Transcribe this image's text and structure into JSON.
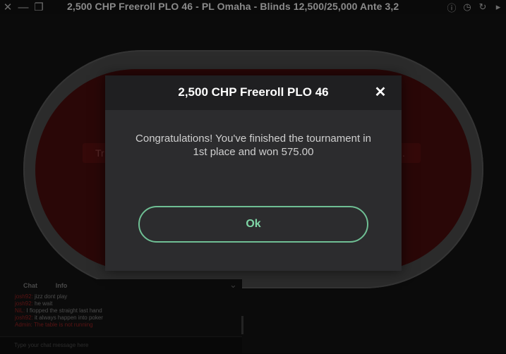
{
  "window": {
    "title": "2,500 CHP Freeroll PLO 46 - PL Omaha - Blinds 12,500/25,000 Ante 3,2"
  },
  "table": {
    "banner_left": "Tr",
    "banner_right": "."
  },
  "chat": {
    "tabs": [
      "Chat",
      "Info"
    ],
    "messages": [
      {
        "nick": "josh92:",
        "text": " jizz dont play"
      },
      {
        "nick": "josh92:",
        "text": " he wait"
      },
      {
        "nick": "NiL:",
        "text": " I flopped the straight last hand"
      },
      {
        "nick": "josh92:",
        "text": " it always happen into poker"
      },
      {
        "nick": "Admin:",
        "text": " The table is not running",
        "admin": true
      }
    ],
    "input_placeholder": "Type your chat message here"
  },
  "modal": {
    "title": "2,500 CHP Freeroll PLO 46",
    "message": "Congratulations! You've finished the tournament in 1st place and won 575.00",
    "ok_label": "Ok",
    "accent_color": "#6fbf94"
  }
}
